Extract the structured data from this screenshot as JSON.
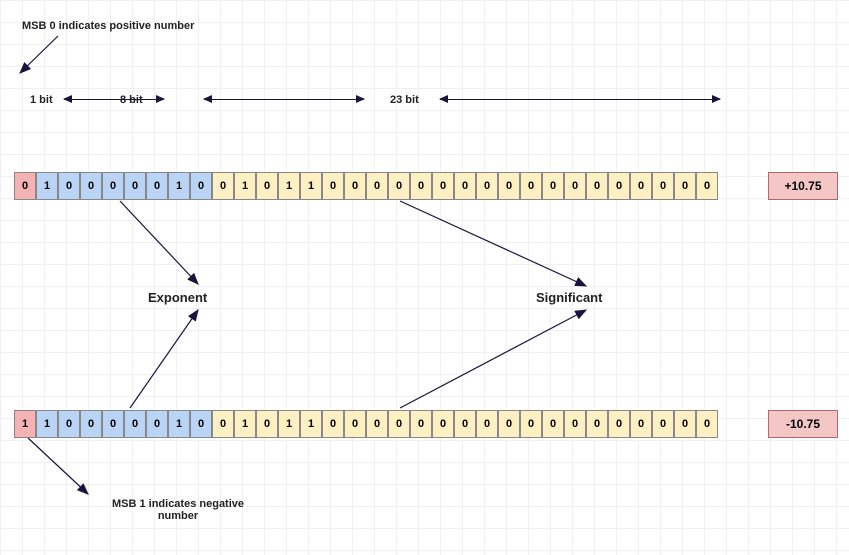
{
  "colors": {
    "sign_cell": "#f5b2b2",
    "exponent_cell": "#b9d4f4",
    "significant_cell": "#fff0c4",
    "value_box": "#f5c6c6",
    "arrow": "#19143d"
  },
  "labels": {
    "msb0": "MSB 0 indicates positive number",
    "msb1": "MSB 1 indicates negative\nnumber",
    "bits1": "1 bit",
    "bits8": "8 bit",
    "bits23": "23 bit",
    "exponent": "Exponent",
    "significant": "Significant"
  },
  "rows": [
    {
      "name": "positive",
      "sign": "0",
      "exponent": [
        "1",
        "0",
        "0",
        "0",
        "0",
        "0",
        "1",
        "0"
      ],
      "significant": [
        "0",
        "1",
        "0",
        "1",
        "1",
        "0",
        "0",
        "0",
        "0",
        "0",
        "0",
        "0",
        "0",
        "0",
        "0",
        "0",
        "0",
        "0",
        "0",
        "0",
        "0",
        "0",
        "0"
      ],
      "value": "+10.75"
    },
    {
      "name": "negative",
      "sign": "1",
      "exponent": [
        "1",
        "0",
        "0",
        "0",
        "0",
        "0",
        "1",
        "0"
      ],
      "significant": [
        "0",
        "1",
        "0",
        "1",
        "1",
        "0",
        "0",
        "0",
        "0",
        "0",
        "0",
        "0",
        "0",
        "0",
        "0",
        "0",
        "0",
        "0",
        "0",
        "0",
        "0",
        "0",
        "0"
      ],
      "value": "-10.75"
    }
  ]
}
